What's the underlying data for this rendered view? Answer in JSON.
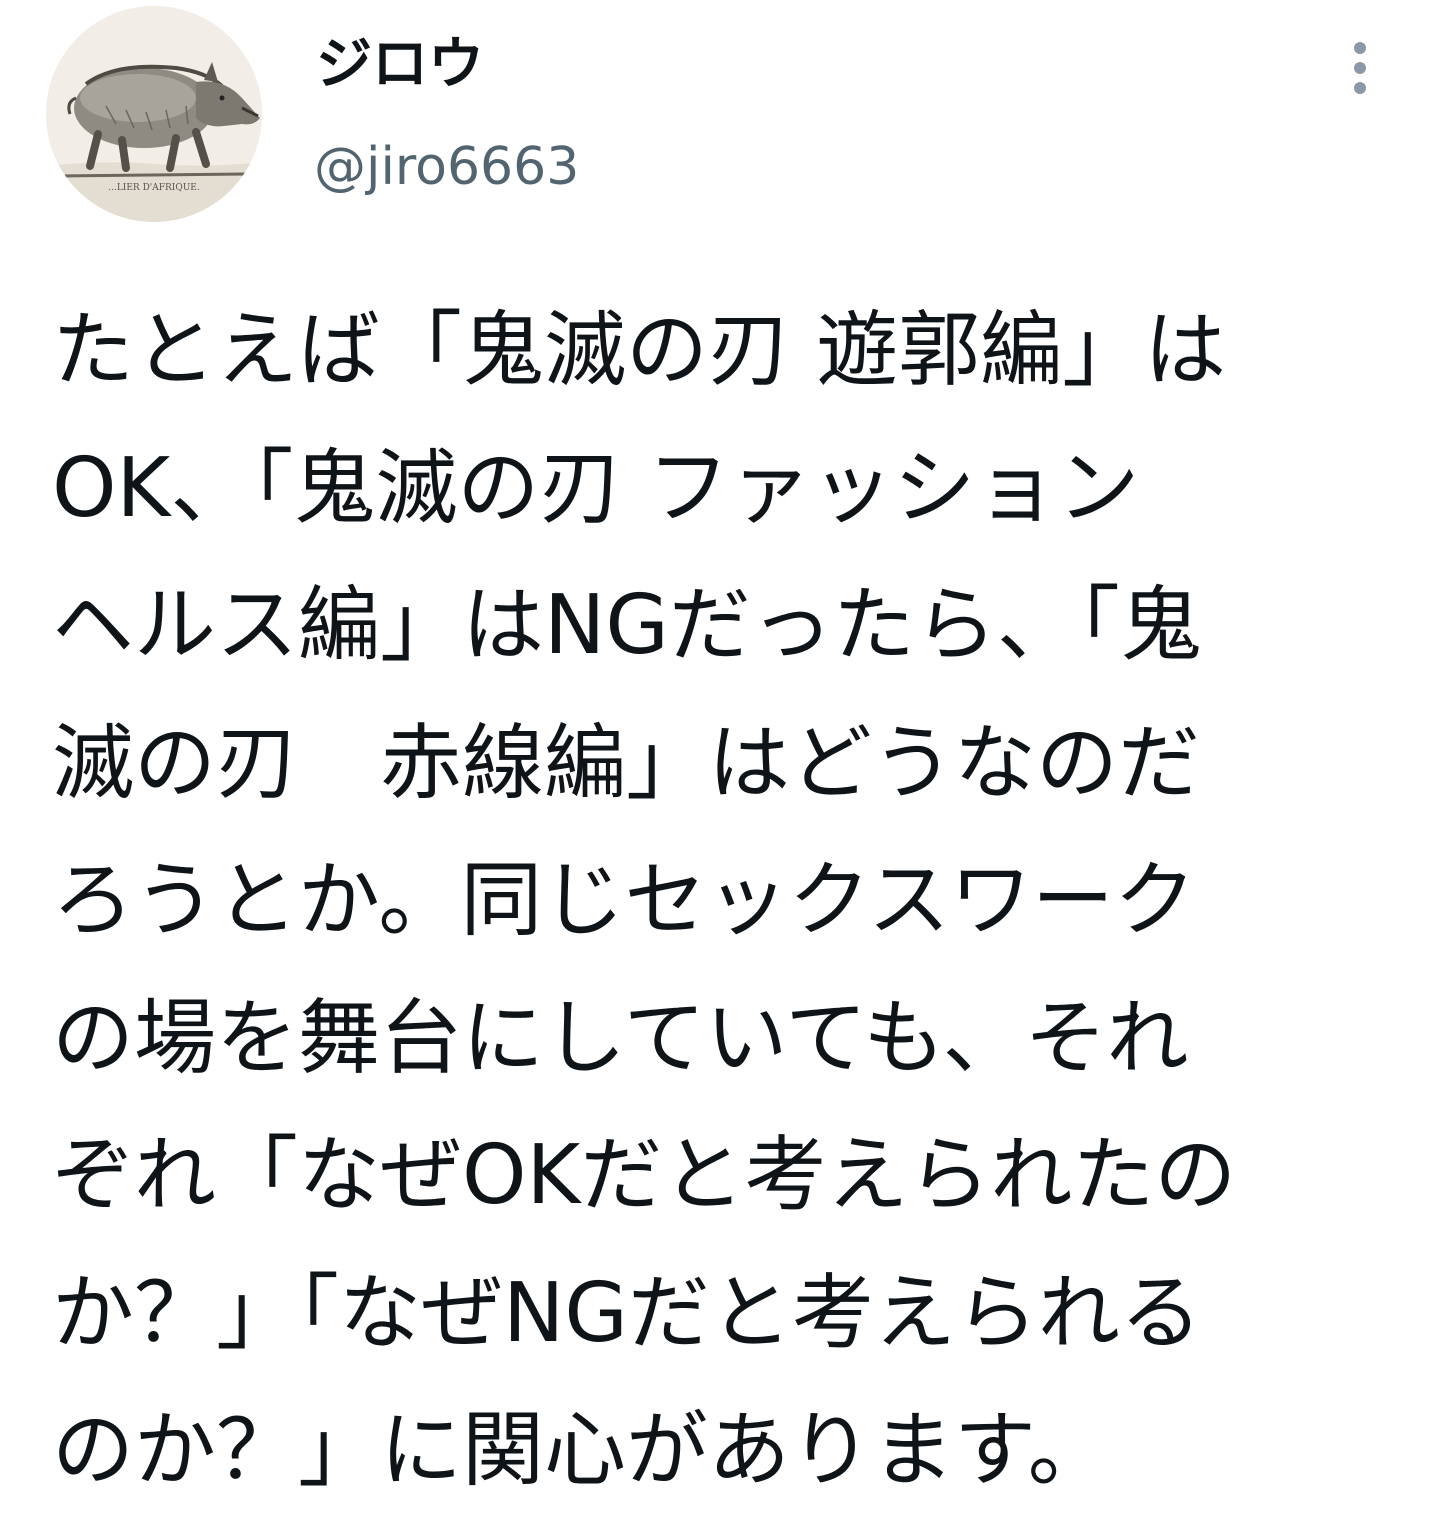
{
  "tweet": {
    "avatar_icon": "boar-illustration-avatar",
    "avatar_caption": "...LIER D'AFRIQUE.",
    "display_name": "ジロウ",
    "handle": "@jiro6663",
    "more_icon": "more-vertical-icon",
    "text_lines": [
      "たとえば「鬼滅の刃 遊郭編」は",
      "OK、「鬼滅の刃 ファッション",
      "ヘルス編」はNGだったら、「鬼",
      "滅の刃　赤線編」はどうなのだ",
      "ろうとか。同じセックスワーク",
      "の場を舞台にしていても、それ",
      "ぞれ「なぜOKだと考えられたの",
      "か？」「なぜNGだと考えられる",
      "のか？」に関心があります。"
    ]
  },
  "colors": {
    "text_primary": "#0f1419",
    "text_secondary": "#536471",
    "icon_gray": "#8b98a5"
  }
}
